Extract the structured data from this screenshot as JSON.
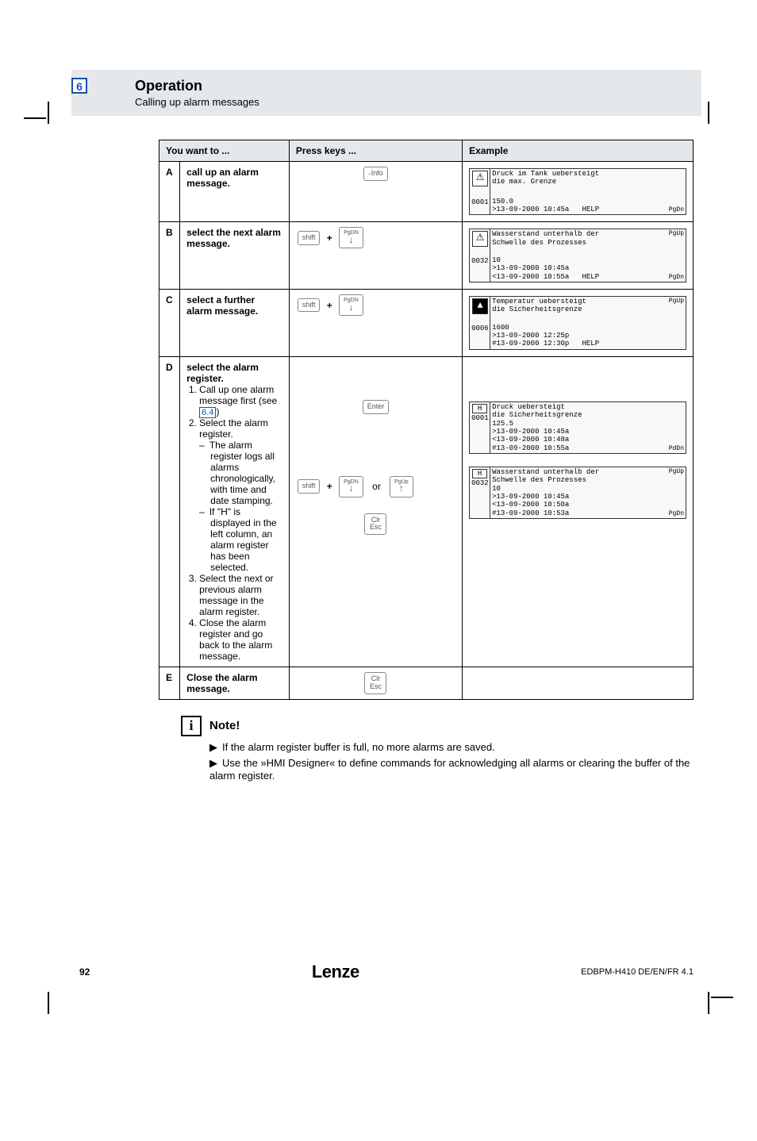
{
  "header": {
    "chapter": "6",
    "title": "Operation",
    "subtitle": "Calling up alarm messages"
  },
  "table": {
    "headers": {
      "h1": "",
      "h2": "You want to ...",
      "h3": "Press keys ...",
      "h4": "Example"
    },
    "rows": {
      "A": {
        "id": "A",
        "desc": "call up an alarm message.",
        "key_info": "Info",
        "lcd": {
          "icon": "!",
          "top1": "Druck im Tank uebersteigt",
          "top2": "die max. Grenze",
          "left": "0001",
          "b1": "150.0",
          "b2": ">13-09-2000 10:45a",
          "help": "HELP",
          "side_bot": "PgDn"
        }
      },
      "B": {
        "id": "B",
        "desc": "select the next alarm message.",
        "key_shift": "shift",
        "key_pgdn": "PgDN",
        "lcd": {
          "icon": "⚠",
          "top1": "Wasserstand unterhalb der",
          "top2": "Schwelle des Prozesses",
          "left": "0032",
          "b1": "10",
          "b2": ">13-09-2000 10:45a",
          "b3": "<13-09-2000 10:55a",
          "help": "HELP",
          "side_top": "PgUp",
          "side_bot": "PgDn"
        }
      },
      "C": {
        "id": "C",
        "desc": "select a further alarm message.",
        "key_shift": "shift",
        "key_pgdn": "PgDN",
        "lcd": {
          "icon": "▲",
          "top1": "Temperatur uebersteigt",
          "top2": "die Sicherheitsgrenze",
          "left": "0006",
          "b1": "1600",
          "b2": ">13-09-2000 12:25p",
          "b3": "#13-09-2000 12:30p",
          "help": "HELP",
          "side_top": "PgUp"
        }
      },
      "D": {
        "id": "D",
        "title": "select the alarm register.",
        "s1": "Call up one alarm message first (see ",
        "s1link": "6.4",
        "s1after": ")",
        "s2": "Select the alarm register.",
        "s2a": "The alarm register logs all alarms chronologically, with time and date stamping.",
        "s2b": "If \"H\" is displayed in the left column, an alarm register has been selected.",
        "s3": "Select the next or previous alarm message in the alarm register.",
        "s4": "Close the alarm register and go back to the alarm message.",
        "key_enter": "Enter",
        "key_shift": "shift",
        "key_pgdn": "PgDN",
        "key_pgup": "PgUp",
        "or": "or",
        "key_clr": "Clr",
        "key_esc": "Esc",
        "lcd1": {
          "h": "H",
          "left": "0001",
          "t1": "Druck uebersteigt",
          "t2": "die Sicherheitsgrenze",
          "b1": "125.5",
          "b2": ">13-09-2000 10:45a",
          "b3": "<13-09-2000 10:48a",
          "b4": "#13-09-2000 10:55a",
          "side_bot": "PdDn"
        },
        "lcd2": {
          "h": "H",
          "left": "0032",
          "t1": "Wasserstand unterhalb der",
          "t2": "Schwelle des Prozesses",
          "b1": "10",
          "b2": ">13-09-2000 10:45a",
          "b3": "<13-09-2000 10:50a",
          "b4": "#13-09-2000 10:53a",
          "side_top": "PgUp",
          "side_bot": "PgDn"
        }
      },
      "E": {
        "id": "E",
        "desc": "Close the alarm message.",
        "key_clr": "Clr",
        "key_esc": "Esc"
      }
    }
  },
  "note": {
    "title": "Note!",
    "b1": "If the alarm register buffer is full, no more alarms are saved.",
    "b2": "Use the »HMI Designer« to define commands for acknowledging all alarms or clearing the buffer of the alarm register."
  },
  "footer": {
    "page": "92",
    "brand": "Lenze",
    "docid": "EDBPM-H410 DE/EN/FR 4.1"
  }
}
